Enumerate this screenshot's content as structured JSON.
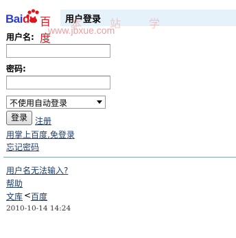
{
  "header": {
    "logo_latin_a": "Bai",
    "logo_latin_b": "du",
    "logo_cn": "百度",
    "title": "用户登录",
    "watermark_url": "www.jbxue.com",
    "watermark_cn": "本 站 学",
    "band_color": "#e6f2fa"
  },
  "form": {
    "username_label": "用户名:",
    "username_value": "",
    "password_label": "密码:",
    "password_value": "",
    "autologin_selected": "不使用自动登录",
    "login_button": "登录",
    "register_link": "注册"
  },
  "links": {
    "palm_login": "用掌上百度,免登录",
    "forgot_password": "忘记密码",
    "cannot_input": "用户名无法输入?",
    "help": "帮助",
    "wenku": "文库",
    "separator": "<",
    "baidu": "百度"
  },
  "footer": {
    "timestamp": "2010-10-14 14:24"
  },
  "colors": {
    "logo_blue": "#2a3bd2",
    "logo_red": "#e0141c",
    "link": "#1e3f6e",
    "divider": "#7fa6b8"
  },
  "icons": {
    "logo_paw": "paw-icon",
    "select_arrow": "chevron-down-icon"
  }
}
